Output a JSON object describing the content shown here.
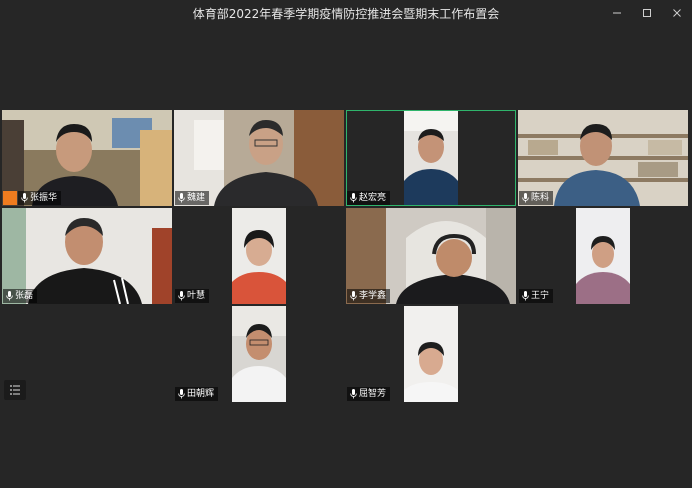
{
  "window": {
    "title": "体育部2022年春季学期疫情防控推进会暨期末工作布置会"
  },
  "participants": [
    {
      "name": "张振华",
      "mic": "on",
      "host": true
    },
    {
      "name": "魏建",
      "mic": "on"
    },
    {
      "name": "赵宏亮",
      "mic": "on",
      "speaking": true
    },
    {
      "name": "陈科",
      "mic": "on"
    },
    {
      "name": "张磊",
      "mic": "on"
    },
    {
      "name": "叶慧",
      "mic": "on"
    },
    {
      "name": "李学鑫",
      "mic": "on"
    },
    {
      "name": "王宁",
      "mic": "on"
    },
    {
      "name": "田朝辉",
      "mic": "on"
    },
    {
      "name": "屈智芳",
      "mic": "on"
    }
  ],
  "colors": {
    "background": "#262626",
    "active_border": "#2fb46b",
    "host_badge": "#f07c1f"
  },
  "icons": {
    "minimize": "minimize-icon",
    "maximize": "maximize-icon",
    "close": "close-icon",
    "mic": "microphone-icon",
    "menu": "list-menu-icon"
  }
}
